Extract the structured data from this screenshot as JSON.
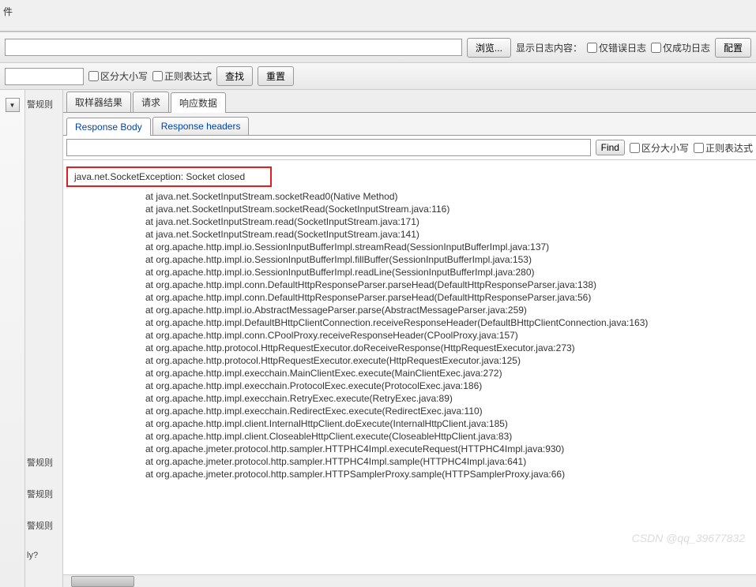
{
  "top": {
    "label_file": "件",
    "browse_btn": "浏览...",
    "show_log_label": "显示日志内容：",
    "chk_error_only": "仅错误日志",
    "chk_success_only": "仅成功日志",
    "config_btn": "配置"
  },
  "search_bar": {
    "chk_case": "区分大小写",
    "chk_regex": "正则表达式",
    "btn_find": "查找",
    "btn_reset": "重置"
  },
  "left": {
    "items": [
      "警规则",
      "警规则",
      "警规则",
      "警规则",
      "ly?"
    ]
  },
  "tabs_outer": {
    "sampler": "取样器结果",
    "request": "请求",
    "response": "响应数据"
  },
  "tabs_inner": {
    "body": "Response Body",
    "headers": "Response headers"
  },
  "inner_search": {
    "btn_find": "Find",
    "chk_case": "区分大小写",
    "chk_regex": "正则表达式"
  },
  "response": {
    "exception": "java.net.SocketException: Socket closed",
    "stack": [
      "at java.net.SocketInputStream.socketRead0(Native Method)",
      "at java.net.SocketInputStream.socketRead(SocketInputStream.java:116)",
      "at java.net.SocketInputStream.read(SocketInputStream.java:171)",
      "at java.net.SocketInputStream.read(SocketInputStream.java:141)",
      "at org.apache.http.impl.io.SessionInputBufferImpl.streamRead(SessionInputBufferImpl.java:137)",
      "at org.apache.http.impl.io.SessionInputBufferImpl.fillBuffer(SessionInputBufferImpl.java:153)",
      "at org.apache.http.impl.io.SessionInputBufferImpl.readLine(SessionInputBufferImpl.java:280)",
      "at org.apache.http.impl.conn.DefaultHttpResponseParser.parseHead(DefaultHttpResponseParser.java:138)",
      "at org.apache.http.impl.conn.DefaultHttpResponseParser.parseHead(DefaultHttpResponseParser.java:56)",
      "at org.apache.http.impl.io.AbstractMessageParser.parse(AbstractMessageParser.java:259)",
      "at org.apache.http.impl.DefaultBHttpClientConnection.receiveResponseHeader(DefaultBHttpClientConnection.java:163)",
      "at org.apache.http.impl.conn.CPoolProxy.receiveResponseHeader(CPoolProxy.java:157)",
      "at org.apache.http.protocol.HttpRequestExecutor.doReceiveResponse(HttpRequestExecutor.java:273)",
      "at org.apache.http.protocol.HttpRequestExecutor.execute(HttpRequestExecutor.java:125)",
      "at org.apache.http.impl.execchain.MainClientExec.execute(MainClientExec.java:272)",
      "at org.apache.http.impl.execchain.ProtocolExec.execute(ProtocolExec.java:186)",
      "at org.apache.http.impl.execchain.RetryExec.execute(RetryExec.java:89)",
      "at org.apache.http.impl.execchain.RedirectExec.execute(RedirectExec.java:110)",
      "at org.apache.http.impl.client.InternalHttpClient.doExecute(InternalHttpClient.java:185)",
      "at org.apache.http.impl.client.CloseableHttpClient.execute(CloseableHttpClient.java:83)",
      "at org.apache.jmeter.protocol.http.sampler.HTTPHC4Impl.executeRequest(HTTPHC4Impl.java:930)",
      "at org.apache.jmeter.protocol.http.sampler.HTTPHC4Impl.sample(HTTPHC4Impl.java:641)",
      "at org.apache.jmeter.protocol.http.sampler.HTTPSamplerProxy.sample(HTTPSamplerProxy.java:66)"
    ]
  },
  "watermark": "CSDN @qq_39677832"
}
